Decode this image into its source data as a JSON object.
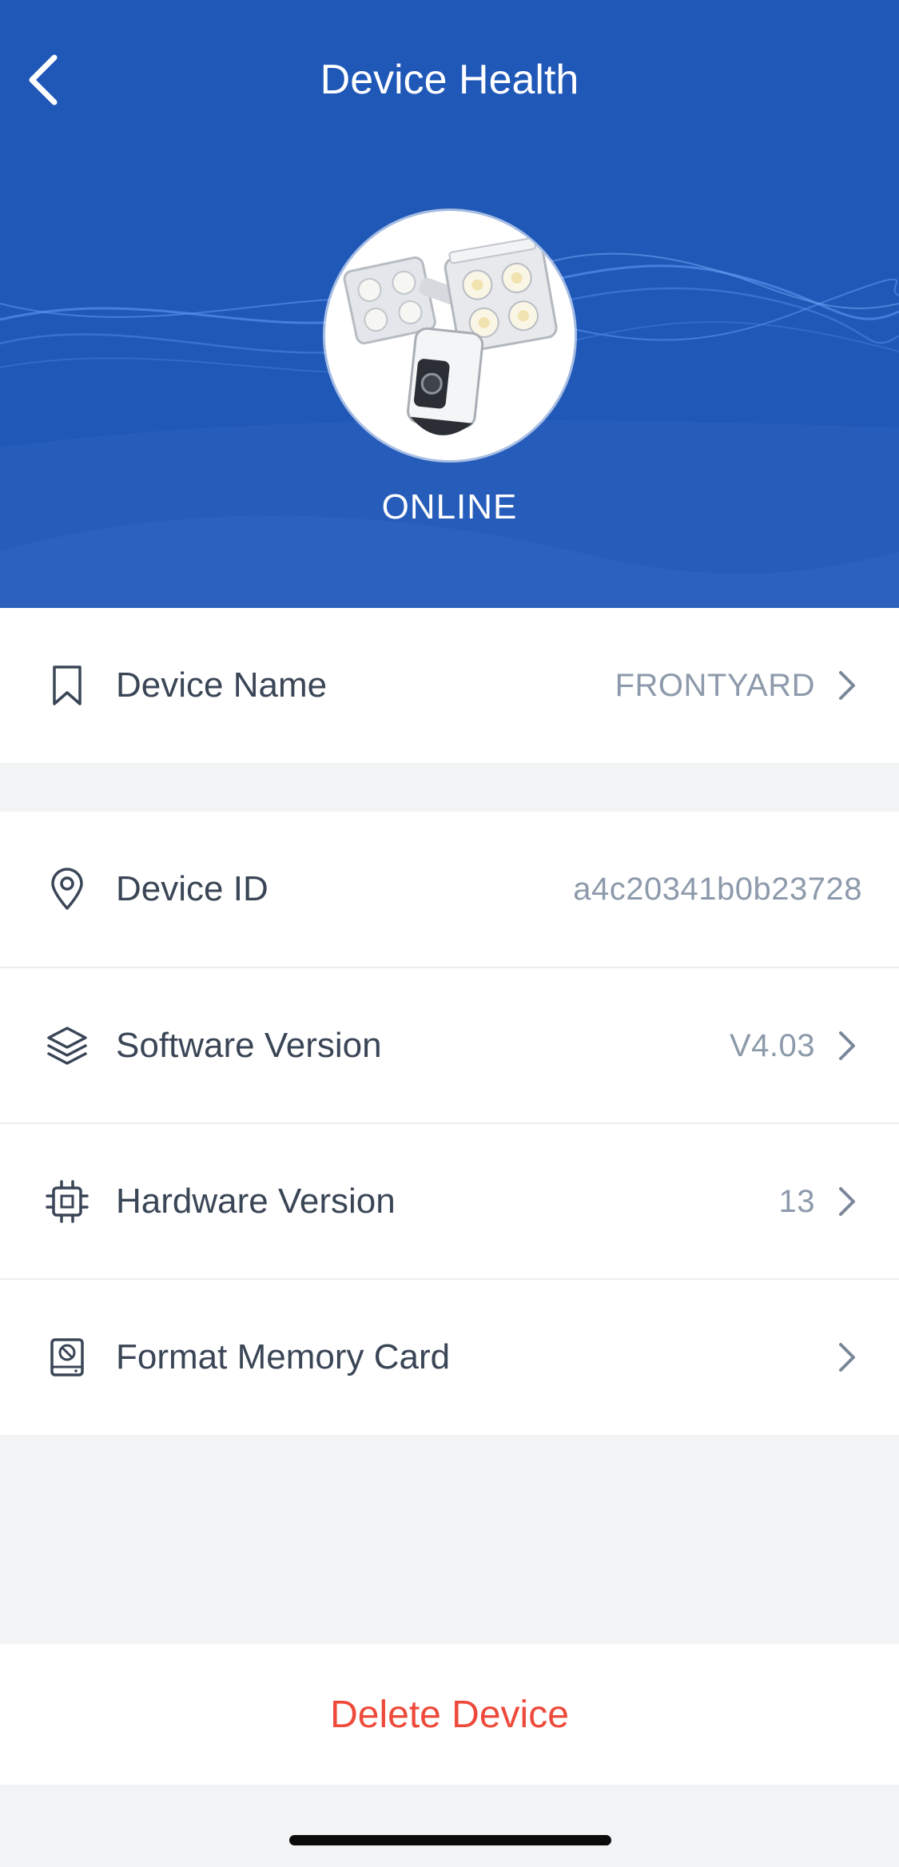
{
  "header": {
    "title": "Device Health",
    "status": "ONLINE",
    "background_color": "#2058b8"
  },
  "icons": {
    "back": "chevron-left-icon",
    "device_name": "bookmark-icon",
    "device_id": "location-pin-icon",
    "software_version": "layers-icon",
    "hardware_version": "chip-icon",
    "format_memory_card": "memory-card-icon",
    "row_chevron": "chevron-right-icon"
  },
  "rows": {
    "device_name": {
      "label": "Device Name",
      "value": "FRONTYARD"
    },
    "device_id": {
      "label": "Device ID",
      "value": "a4c20341b0b23728"
    },
    "software_version": {
      "label": "Software Version",
      "value": "V4.03"
    },
    "hardware_version": {
      "label": "Hardware Version",
      "value": "13"
    },
    "format_memory_card": {
      "label": "Format Memory Card"
    }
  },
  "actions": {
    "delete_label": "Delete Device",
    "delete_color": "#ee4a3b"
  }
}
